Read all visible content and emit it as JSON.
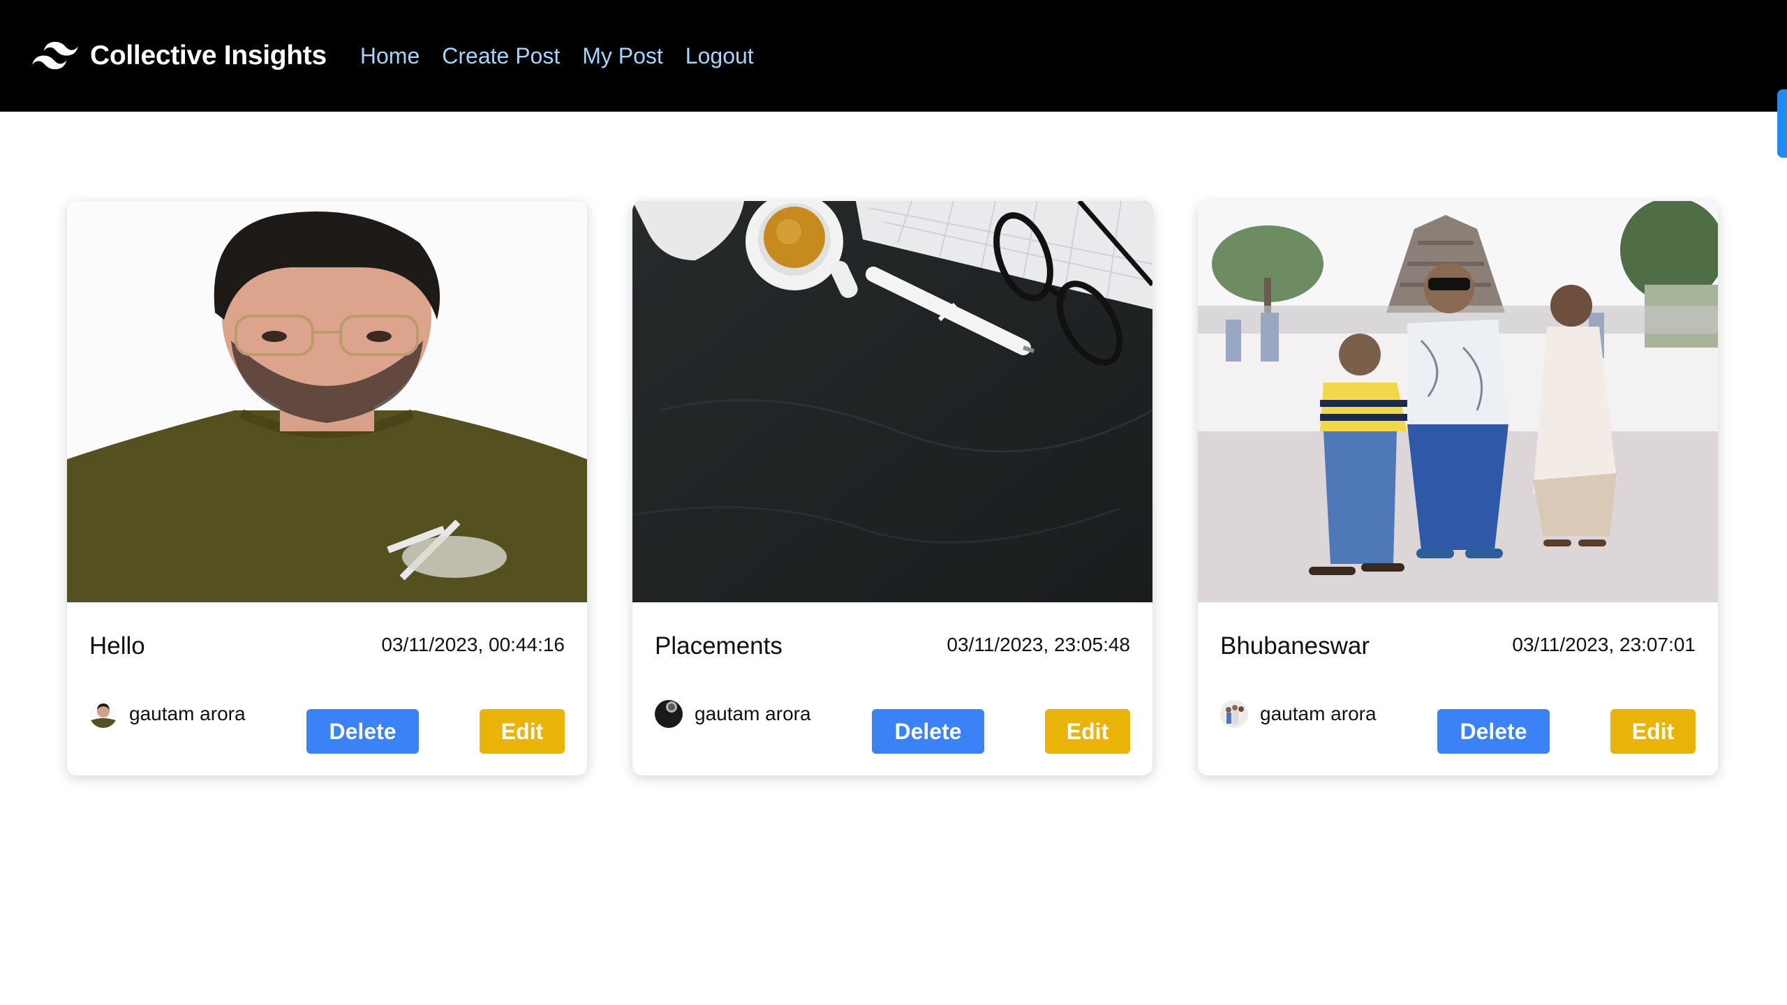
{
  "brand": {
    "name": "Collective Insights",
    "logo_icon": "tailwind-wave-icon"
  },
  "nav": {
    "links": [
      {
        "label": "Home"
      },
      {
        "label": "Create Post"
      },
      {
        "label": "My Post"
      },
      {
        "label": "Logout"
      }
    ]
  },
  "colors": {
    "navbar_bg": "#000000",
    "nav_link": "#a7d3fd",
    "delete_button": "#3b82f6",
    "edit_button": "#eab308",
    "scroll_tab": "#1d8cf8"
  },
  "posts": [
    {
      "image_icon": "portrait-photo",
      "title": "Hello",
      "date": "03/11/2023, 00:44:16",
      "author": "gautam arora",
      "delete_label": "Delete",
      "edit_label": "Edit"
    },
    {
      "image_icon": "desk-coffee-keyboard-photo",
      "title": "Placements",
      "date": "03/11/2023, 23:05:48",
      "author": "gautam arora",
      "delete_label": "Delete",
      "edit_label": "Edit"
    },
    {
      "image_icon": "temple-family-photo",
      "title": "Bhubaneswar",
      "date": "03/11/2023, 23:07:01",
      "author": "gautam arora",
      "delete_label": "Delete",
      "edit_label": "Edit"
    }
  ]
}
